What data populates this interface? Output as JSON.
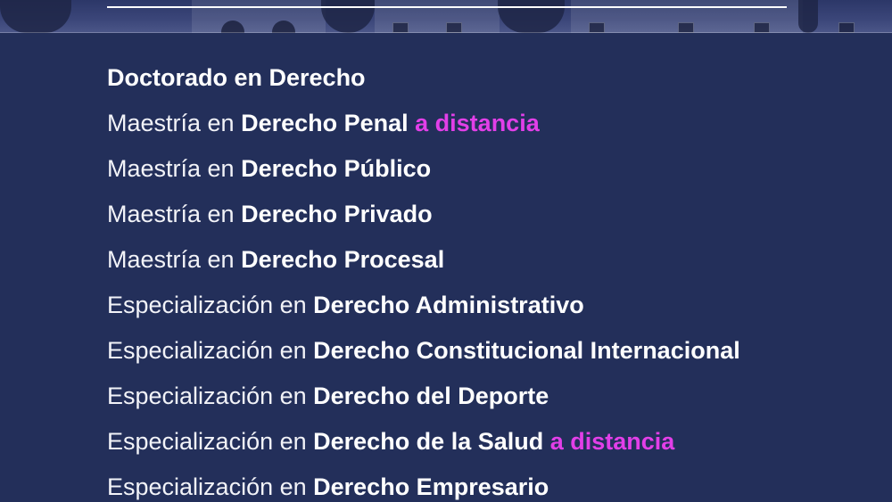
{
  "colors": {
    "background": "#232f5a",
    "text": "#ffffff",
    "accent_distance": "#e23fe8"
  },
  "programs": [
    {
      "prefix": "",
      "name": "Doctorado en Derecho",
      "modality": ""
    },
    {
      "prefix": "Maestría en ",
      "name": "Derecho Penal",
      "modality": " a distancia"
    },
    {
      "prefix": "Maestría en ",
      "name": "Derecho Público",
      "modality": ""
    },
    {
      "prefix": "Maestría en ",
      "name": "Derecho Privado",
      "modality": ""
    },
    {
      "prefix": "Maestría en ",
      "name": "Derecho Procesal",
      "modality": ""
    },
    {
      "prefix": "Especialización en ",
      "name": "Derecho Administrativo",
      "modality": ""
    },
    {
      "prefix": "Especialización en ",
      "name": "Derecho Constitucional Internacional",
      "modality": ""
    },
    {
      "prefix": "Especialización en ",
      "name": "Derecho del Deporte",
      "modality": ""
    },
    {
      "prefix": "Especialización en ",
      "name": "Derecho de la Salud",
      "modality": " a distancia"
    },
    {
      "prefix": "Especialización en ",
      "name": "Derecho Empresario",
      "modality": ""
    }
  ]
}
